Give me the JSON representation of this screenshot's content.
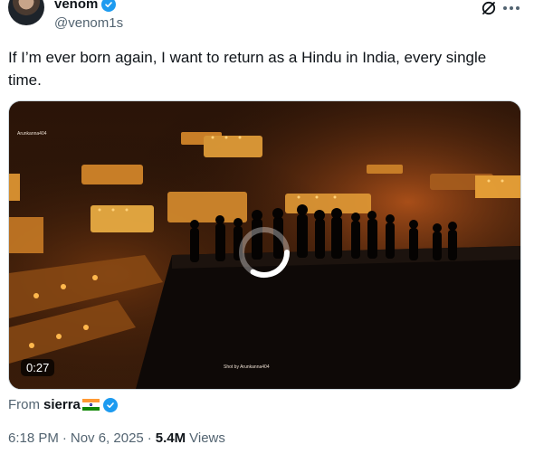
{
  "author": {
    "name": "venom",
    "handle": "@venom1s"
  },
  "tweet": {
    "text": "If I’m ever born again, I want to return as a Hindu in India, every single time."
  },
  "media": {
    "watermark_top": "Arunkanna404",
    "watermark_bottom": "Shot by Arunkanna404",
    "duration": "0:27"
  },
  "source": {
    "prefix": "From",
    "name": "sierra"
  },
  "meta": {
    "time": "6:18 PM",
    "sep1": "·",
    "date": "Nov 6, 2025",
    "sep2": "·",
    "views_count": "5.4M",
    "views_label": "Views"
  },
  "colors": {
    "verified": "#1d9bf0",
    "text": "#0f1419",
    "muted": "#536471"
  },
  "icons": [
    "verified-badge-icon",
    "grok-icon",
    "more-icon",
    "loading-spinner-icon",
    "india-flag-icon"
  ]
}
